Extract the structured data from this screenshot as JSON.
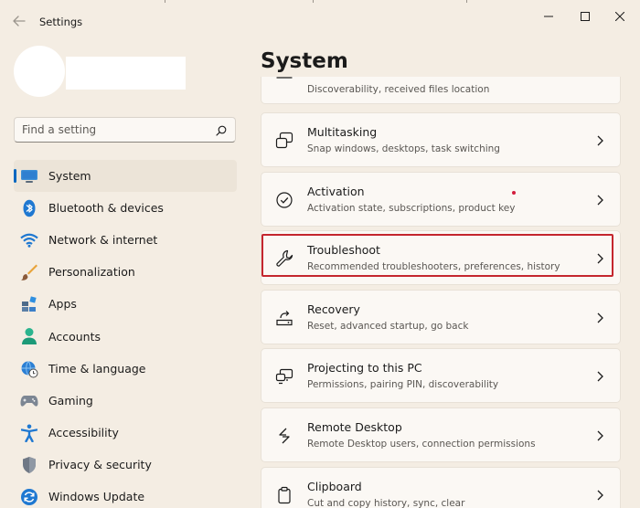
{
  "window": {
    "title": "Settings"
  },
  "search": {
    "placeholder": "Find a setting"
  },
  "nav": {
    "items": [
      {
        "label": "System",
        "icon": "monitor-icon",
        "active": true
      },
      {
        "label": "Bluetooth & devices",
        "icon": "bluetooth-icon"
      },
      {
        "label": "Network & internet",
        "icon": "wifi-icon"
      },
      {
        "label": "Personalization",
        "icon": "paintbrush-icon"
      },
      {
        "label": "Apps",
        "icon": "apps-icon"
      },
      {
        "label": "Accounts",
        "icon": "person-icon"
      },
      {
        "label": "Time & language",
        "icon": "globe-clock-icon"
      },
      {
        "label": "Gaming",
        "icon": "gamepad-icon"
      },
      {
        "label": "Accessibility",
        "icon": "accessibility-icon"
      },
      {
        "label": "Privacy & security",
        "icon": "shield-icon"
      },
      {
        "label": "Windows Update",
        "icon": "update-icon"
      }
    ]
  },
  "main": {
    "title": "System",
    "partial_item": {
      "subtitle": "Discoverability, received files location"
    },
    "items": [
      {
        "title": "Multitasking",
        "subtitle": "Snap windows, desktops, task switching",
        "icon": "multitasking-icon"
      },
      {
        "title": "Activation",
        "subtitle": "Activation state, subscriptions, product key",
        "icon": "check-circle-icon"
      },
      {
        "title": "Troubleshoot",
        "subtitle": "Recommended troubleshooters, preferences, history",
        "icon": "wrench-icon",
        "highlighted": true
      },
      {
        "title": "Recovery",
        "subtitle": "Reset, advanced startup, go back",
        "icon": "recovery-icon"
      },
      {
        "title": "Projecting to this PC",
        "subtitle": "Permissions, pairing PIN, discoverability",
        "icon": "projecting-icon"
      },
      {
        "title": "Remote Desktop",
        "subtitle": "Remote Desktop users, connection permissions",
        "icon": "remote-desktop-icon"
      },
      {
        "title": "Clipboard",
        "subtitle": "Cut and copy history, sync, clear",
        "icon": "clipboard-icon"
      }
    ]
  },
  "colors": {
    "background": "#f4ede3",
    "card": "#fbf8f4",
    "accent": "#0067c0",
    "highlight_border": "#c4262e"
  }
}
